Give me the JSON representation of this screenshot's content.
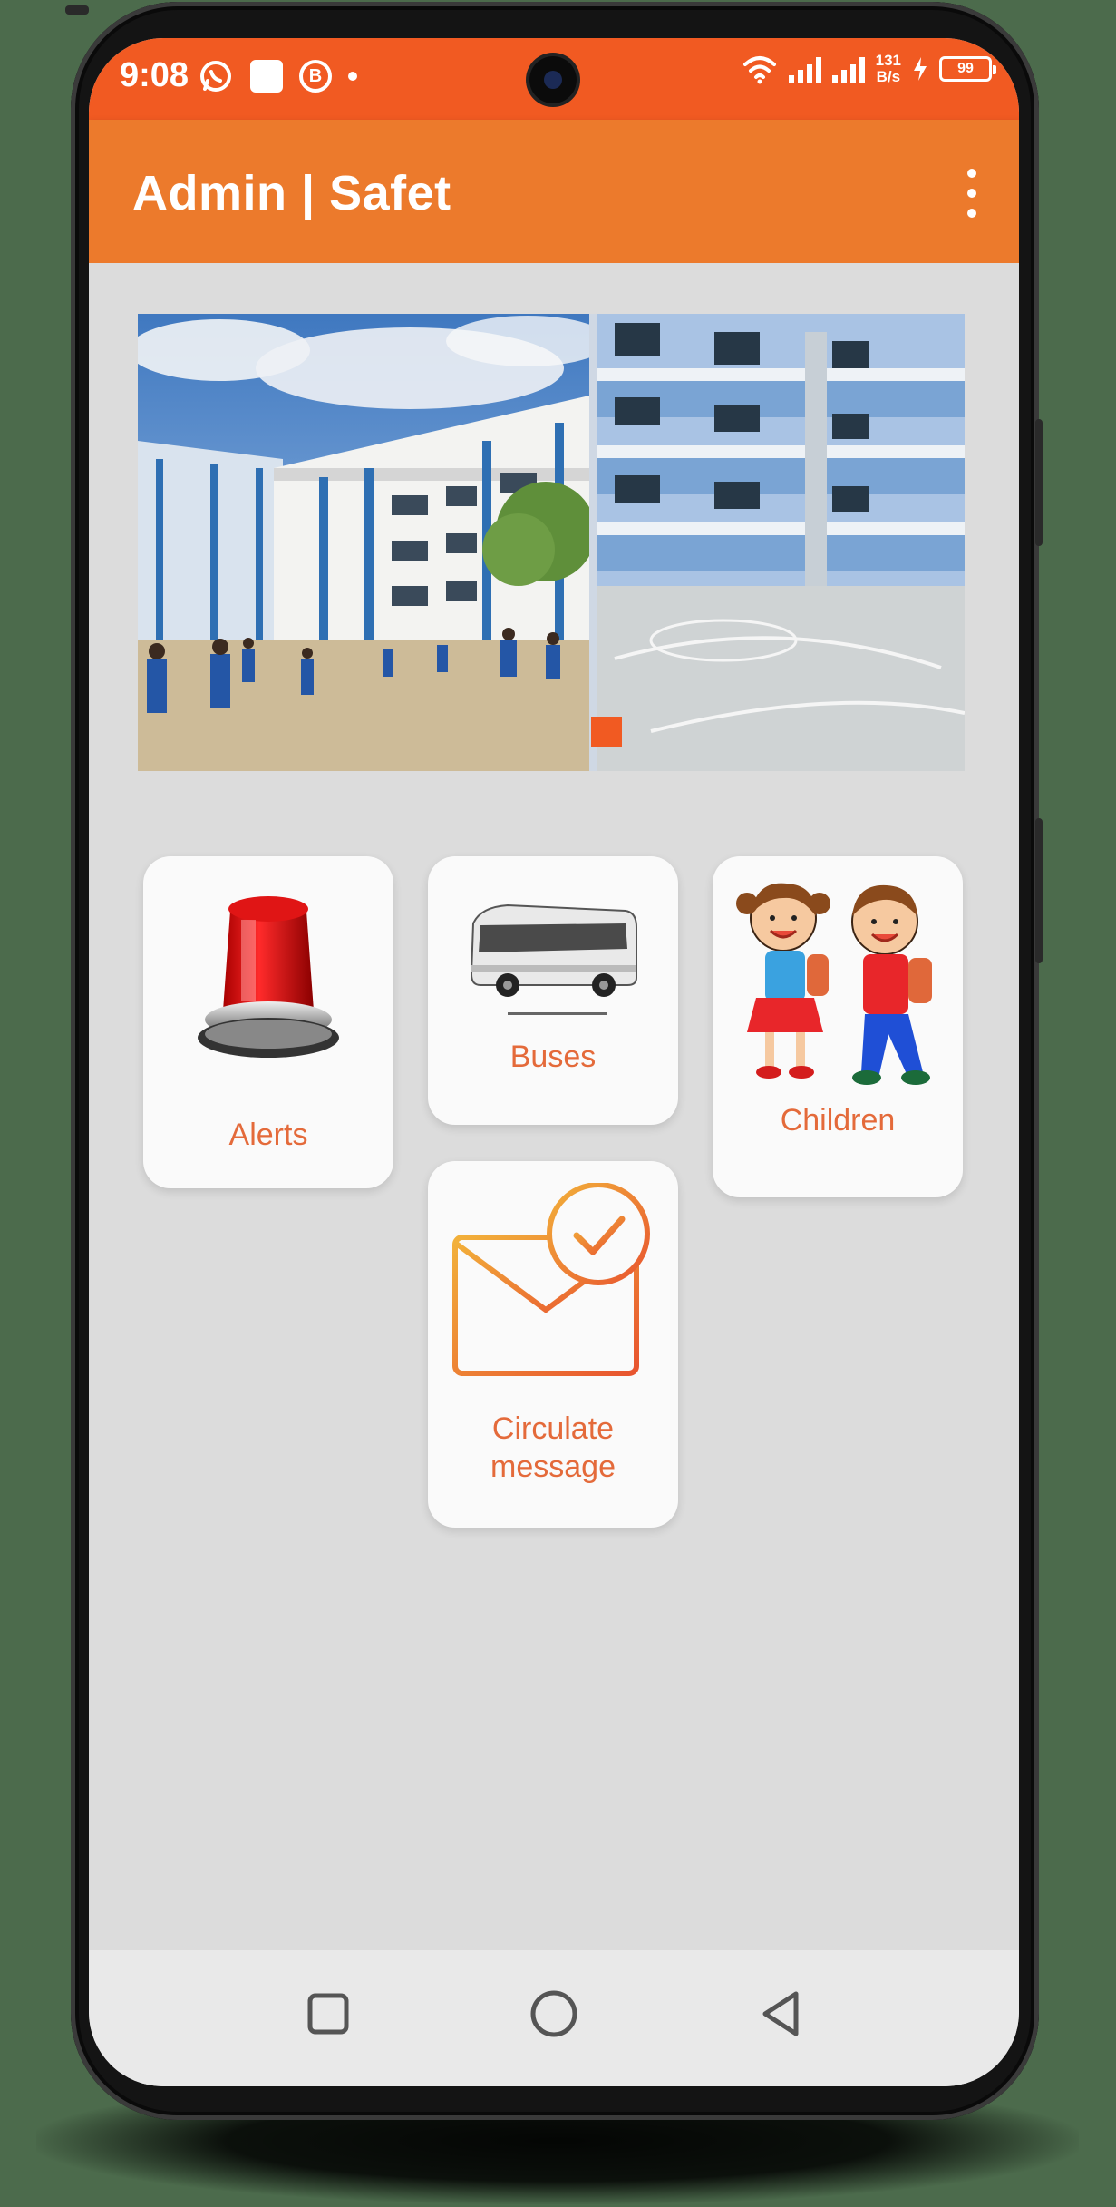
{
  "status_bar": {
    "time": "9:08",
    "notification_icons": [
      "whatsapp-icon",
      "app-square-icon",
      "whatsapp-business-icon",
      "dot-icon"
    ],
    "net_speed_value": "131",
    "net_speed_unit": "B/s",
    "battery": "99"
  },
  "app_bar": {
    "title": "Admin | Safet",
    "menu_icon": "overflow-menu-icon"
  },
  "carousel": {
    "slides": [
      "school-courtyard-photo",
      "school-building-photo"
    ],
    "active_indicator_color": "#f15a22"
  },
  "tiles": {
    "alerts": {
      "label": "Alerts",
      "icon": "siren-icon"
    },
    "buses": {
      "label": "Buses",
      "icon": "bus-icon"
    },
    "children": {
      "label": "Children",
      "icon": "children-icon"
    },
    "circulate": {
      "label_line1": "Circulate",
      "label_line2": "message",
      "icon": "envelope-check-icon"
    }
  },
  "nav_bar": {
    "buttons": [
      "recents-button",
      "home-button",
      "back-button"
    ]
  },
  "colors": {
    "status_bar": "#f15a22",
    "app_bar": "#ec7a2c",
    "tile_label": "#e46a3a",
    "background": "#dcdcdc"
  }
}
